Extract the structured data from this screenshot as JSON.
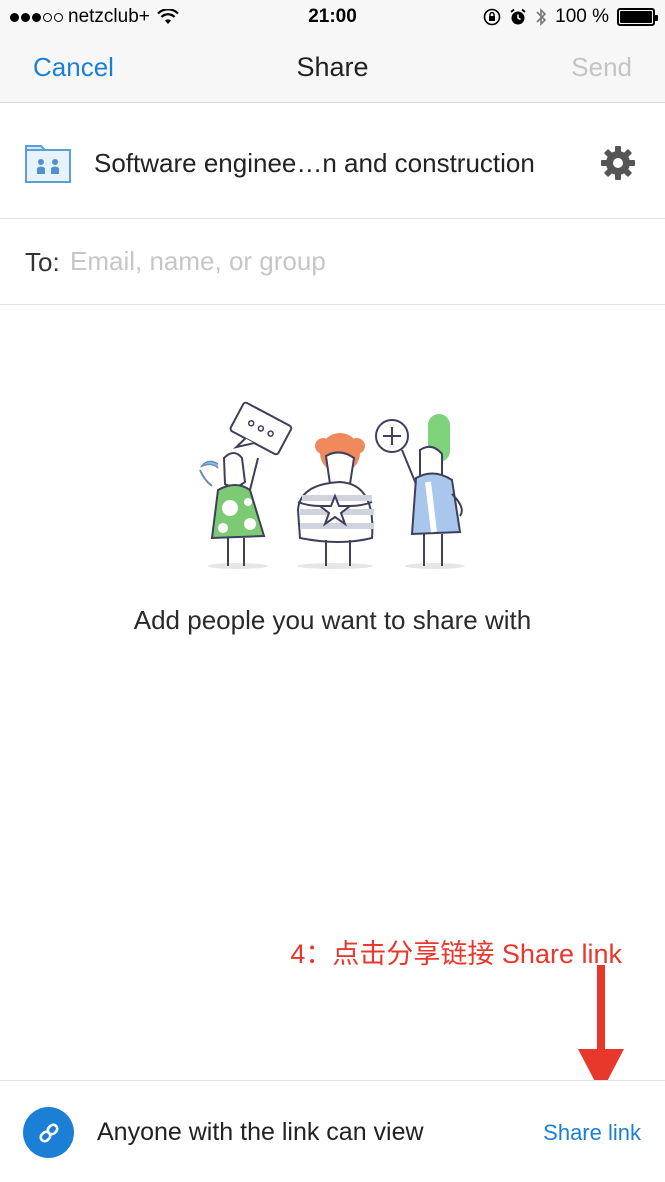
{
  "status_bar": {
    "carrier": "netzclub+",
    "time": "21:00",
    "battery": "100 %",
    "signal_strength_bars": 3,
    "signal_total_bars": 5,
    "icons": [
      "wifi-icon",
      "orientation-lock-icon",
      "alarm-icon",
      "bluetooth-icon",
      "battery-icon"
    ]
  },
  "nav": {
    "cancel": "Cancel",
    "title": "Share",
    "send": "Send"
  },
  "folder": {
    "name": "Software enginee…n and construction",
    "icon": "shared-folder-icon",
    "settings_icon": "gear-icon"
  },
  "to_field": {
    "label": "To:",
    "value": "",
    "placeholder": "Email, name, or group"
  },
  "empty_state": {
    "illustration": "people-sharing-illustration",
    "message": "Add people you want to share with"
  },
  "annotation": {
    "text": "4：点击分享链接 Share link",
    "color": "#e8372b"
  },
  "link_settings": {
    "icon": "link-icon",
    "access": "Anyone with the link can view",
    "share_link": "Share link"
  },
  "colors": {
    "accent": "#1b7fd6",
    "disabled": "#c4c4c4",
    "annotation": "#e8372b"
  }
}
